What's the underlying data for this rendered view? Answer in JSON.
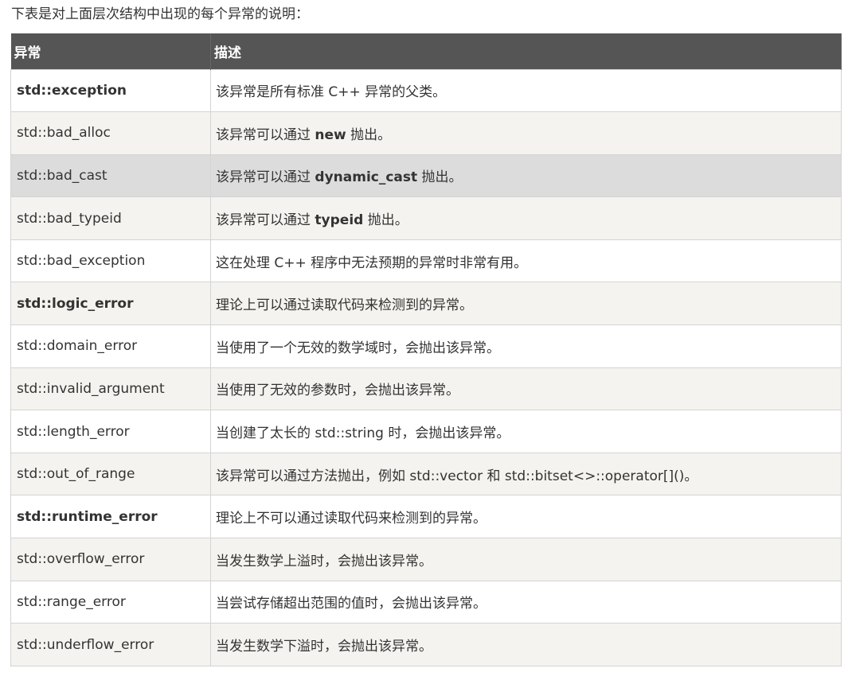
{
  "intro": "下表是对上面层次结构中出现的每个异常的说明：",
  "headers": [
    "异常",
    "描述"
  ],
  "rows": [
    {
      "name": "std::exception",
      "bold": true,
      "desc": [
        "该异常是所有标准 C++ 异常的父类。"
      ]
    },
    {
      "name": "std::bad_alloc",
      "bold": false,
      "desc": [
        "该异常可以通过 ",
        "new",
        " 抛出。"
      ]
    },
    {
      "name": "std::bad_cast",
      "bold": false,
      "desc": [
        "该异常可以通过 ",
        "dynamic_cast",
        " 抛出。"
      ]
    },
    {
      "name": "std::bad_typeid",
      "bold": false,
      "desc": [
        "该异常可以通过 ",
        "typeid",
        " 抛出。"
      ]
    },
    {
      "name": "std::bad_exception",
      "bold": false,
      "desc": [
        "这在处理 C++ 程序中无法预期的异常时非常有用。"
      ]
    },
    {
      "name": "std::logic_error",
      "bold": true,
      "desc": [
        "理论上可以通过读取代码来检测到的异常。"
      ]
    },
    {
      "name": "std::domain_error",
      "bold": false,
      "desc": [
        "当使用了一个无效的数学域时，会抛出该异常。"
      ]
    },
    {
      "name": "std::invalid_argument",
      "bold": false,
      "desc": [
        "当使用了无效的参数时，会抛出该异常。"
      ]
    },
    {
      "name": "std::length_error",
      "bold": false,
      "desc": [
        "当创建了太长的 std::string 时，会抛出该异常。"
      ]
    },
    {
      "name": "std::out_of_range",
      "bold": false,
      "desc": [
        "该异常可以通过方法抛出，例如 std::vector 和 std::bitset<>::operator[]()。"
      ]
    },
    {
      "name": "std::runtime_error",
      "bold": true,
      "desc": [
        "理论上不可以通过读取代码来检测到的异常。"
      ]
    },
    {
      "name": "std::overflow_error",
      "bold": false,
      "desc": [
        "当发生数学上溢时，会抛出该异常。"
      ]
    },
    {
      "name": "std::range_error",
      "bold": false,
      "desc": [
        "当尝试存储超出范围的值时，会抛出该异常。"
      ]
    },
    {
      "name": "std::underflow_error",
      "bold": false,
      "desc": [
        "当发生数学下溢时，会抛出该异常。"
      ]
    }
  ],
  "colors": {
    "header_bg": "#555555",
    "row_alt_bg": "#f4f3ef",
    "row_hover_bg": "#dcdcdc",
    "border": "#d4d4d4"
  }
}
